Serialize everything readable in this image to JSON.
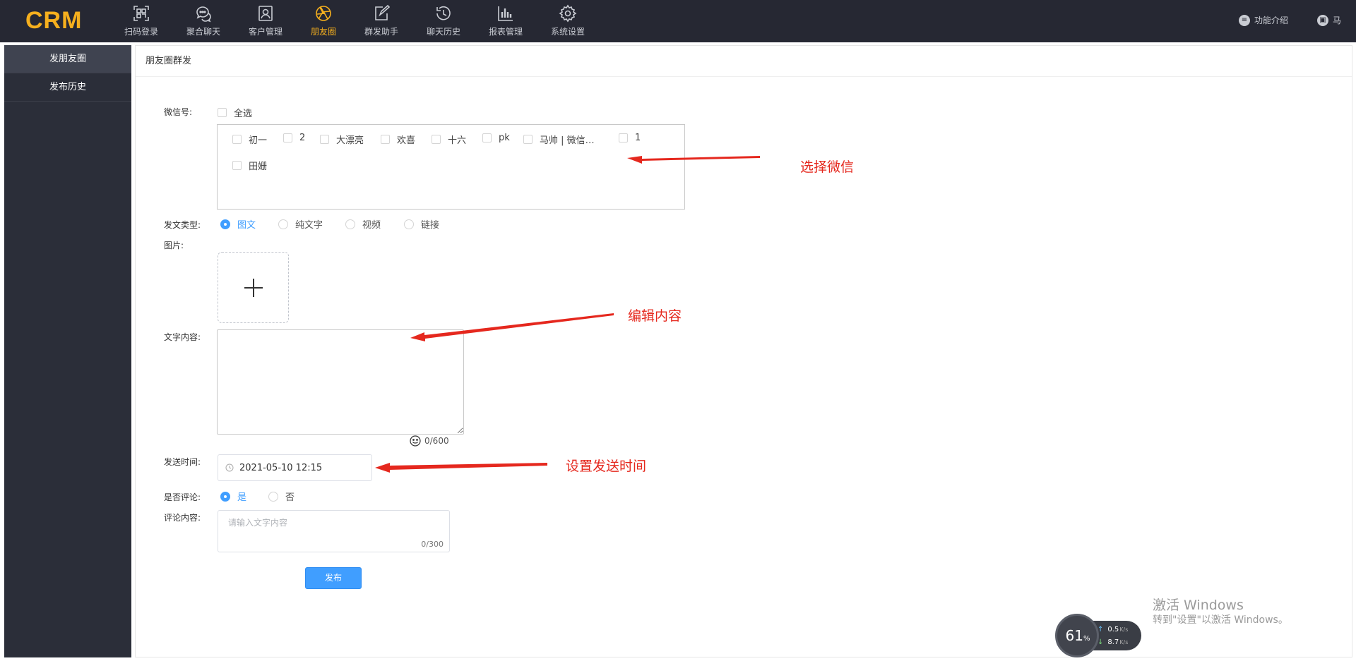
{
  "app": {
    "logo": "CRM"
  },
  "nav": {
    "items": [
      {
        "label": "扫码登录",
        "icon": "qr-scan-icon"
      },
      {
        "label": "聚合聊天",
        "icon": "chat-bubbles-icon"
      },
      {
        "label": "客户管理",
        "icon": "contact-card-icon"
      },
      {
        "label": "朋友圈",
        "icon": "aperture-icon",
        "active": true
      },
      {
        "label": "群发助手",
        "icon": "edit-share-icon"
      },
      {
        "label": "聊天历史",
        "icon": "history-clock-icon"
      },
      {
        "label": "报表管理",
        "icon": "bar-chart-icon"
      },
      {
        "label": "系统设置",
        "icon": "gear-icon"
      }
    ],
    "help_label": "功能介绍",
    "user_name": "马"
  },
  "sidebar": {
    "items": [
      {
        "label": "发朋友圈",
        "active": true
      },
      {
        "label": "发布历史"
      }
    ]
  },
  "panel": {
    "title": "朋友圈群发"
  },
  "form": {
    "wechat": {
      "label": "微信号:",
      "select_all": "全选",
      "accounts": [
        "初一",
        "2",
        "大漂亮",
        "欢喜",
        "十六",
        "pk",
        "马帅 | 微信…",
        "1",
        "田姗"
      ]
    },
    "post_type": {
      "label": "发文类型:",
      "options": [
        "图文",
        "纯文字",
        "视频",
        "链接"
      ],
      "selected": "图文"
    },
    "image": {
      "label": "图片:"
    },
    "text": {
      "label": "文字内容:",
      "counter": "0/600"
    },
    "send_time": {
      "label": "发送时间:",
      "value": "2021-05-10 12:15"
    },
    "allow_comment": {
      "label": "是否评论:",
      "options": [
        "是",
        "否"
      ],
      "selected": "是"
    },
    "comment": {
      "label": "评论内容:",
      "placeholder": "请输入文字内容",
      "counter": "0/300"
    },
    "submit_label": "发布"
  },
  "annotations": {
    "select_wechat": "选择微信",
    "edit_content": "编辑内容",
    "set_time": "设置发送时间",
    "color": "#e5281e"
  },
  "overlay": {
    "watermark_title": "激活 Windows",
    "watermark_sub": "转到\"设置\"以激活 Windows。",
    "speed_percent": "61",
    "speed_percent_unit": "%",
    "upload_speed": "0.5",
    "download_speed": "8.7",
    "speed_unit": "K/s"
  },
  "colors": {
    "topbar": "#262833",
    "accent": "#f6b01e",
    "primary": "#409eff",
    "sidebar": "#2b2e39"
  }
}
